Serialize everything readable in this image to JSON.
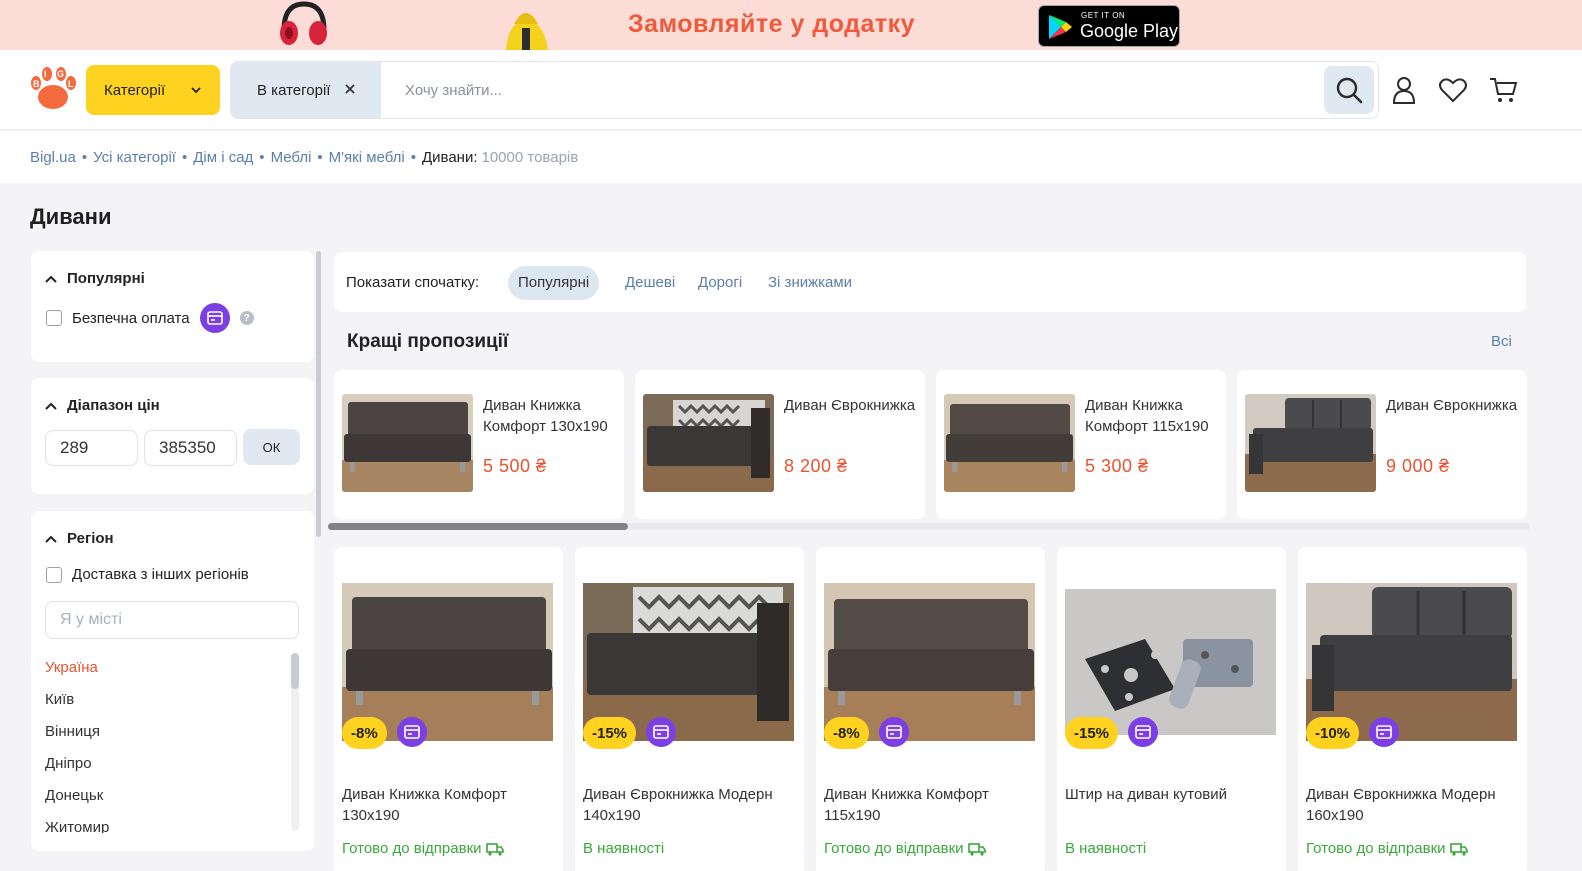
{
  "promo": {
    "text": "Замовляйте у додатку",
    "gplay_small": "GET IT ON",
    "gplay_big": "Google Play"
  },
  "header": {
    "categories_label": "Категорії",
    "in_category_label": "В категорії",
    "search_placeholder": "Хочу знайти...",
    "icons": [
      "search-icon",
      "user-icon",
      "heart-icon",
      "cart-icon"
    ]
  },
  "breadcrumb": {
    "items": [
      "Bigl.ua",
      "Усі категорії",
      "Дім і сад",
      "Меблі",
      "М'які меблі"
    ],
    "current": "Дивани:",
    "count": "10000 товарів"
  },
  "page_title": "Дивани",
  "filters": {
    "popular": {
      "title": "Популярні",
      "safe_payment": "Безпечна оплата",
      "help": "?"
    },
    "price": {
      "title": "Діапазон цін",
      "min": "289",
      "max": "385350",
      "ok": "ОК"
    },
    "region": {
      "title": "Регіон",
      "delivery": "Доставка з інших регіонів",
      "city_placeholder": "Я у місті",
      "items": [
        "Україна",
        "Київ",
        "Вінниця",
        "Дніпро",
        "Донецьк",
        "Житомир"
      ]
    }
  },
  "sort": {
    "label": "Показати спочатку:",
    "options": [
      "Популярні",
      "Дешеві",
      "Дорогі",
      "Зі знижками"
    ],
    "active": "Популярні"
  },
  "best": {
    "title": "Кращі пропозиції",
    "all": "Всі",
    "items": [
      {
        "name": "Диван Книжка Комфорт 130х190",
        "price": "5 500 ₴"
      },
      {
        "name": "Диван Єврокнижка",
        "price": "8 200 ₴"
      },
      {
        "name": "Диван Книжка Комфорт 115х190",
        "price": "5 300 ₴"
      },
      {
        "name": "Диван Єврокнижка",
        "price": "9 000 ₴"
      }
    ]
  },
  "products": [
    {
      "discount": "-8%",
      "name": "Диван Книжка Комфорт 130х190",
      "status": "Готово до відправки"
    },
    {
      "discount": "-15%",
      "name": "Диван Єврокнижка Модерн 140х190",
      "status": "В наявності"
    },
    {
      "discount": "-8%",
      "name": "Диван Книжка Комфорт 115х190",
      "status": "Готово до відправки"
    },
    {
      "discount": "-15%",
      "name": "Штир на диван кутовий",
      "status": "В наявності"
    },
    {
      "discount": "-10%",
      "name": "Диван Єврокнижка Модерн 160х190",
      "status": "Готово до відправки"
    }
  ],
  "colors": {
    "accent_yellow": "#ffd21f",
    "price_orange": "#e8542f",
    "link_blue": "#5b7fa8",
    "pay_purple": "#7b3fe4",
    "status_green": "#3aa93a"
  }
}
